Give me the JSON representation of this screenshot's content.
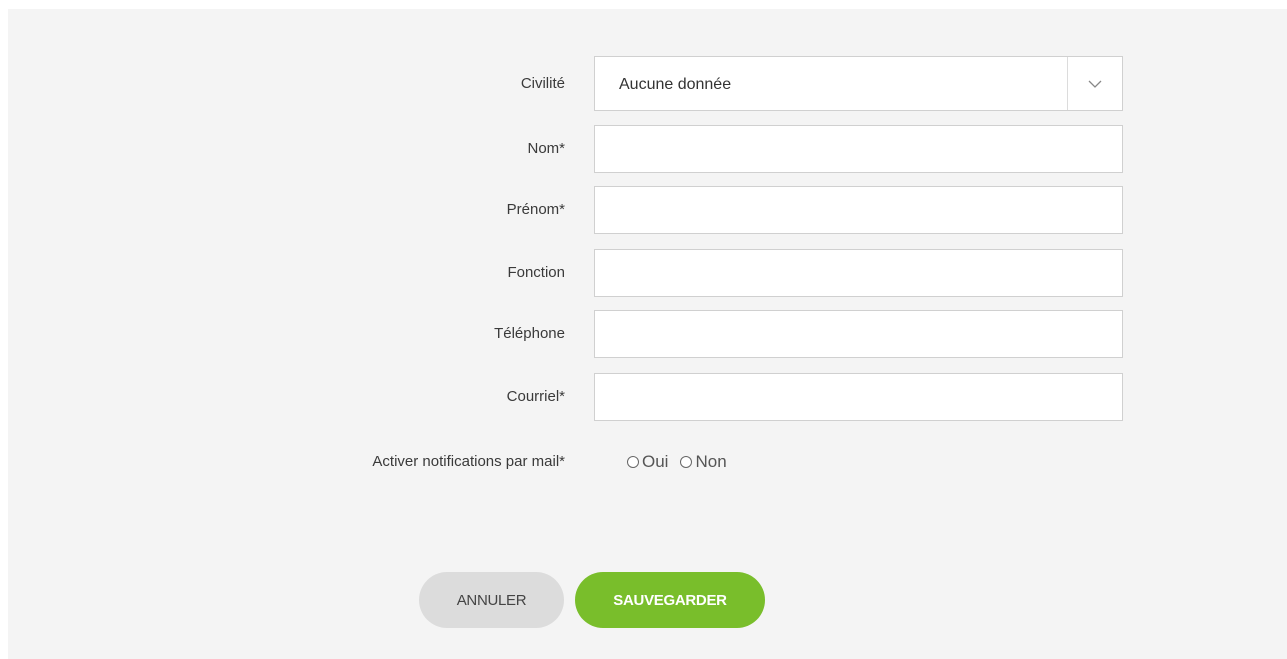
{
  "form": {
    "civilite": {
      "label": "Civilité",
      "selected": "Aucune donnée",
      "chevron_icon": "chevron-down-icon"
    },
    "nom": {
      "label": "Nom*",
      "value": ""
    },
    "prenom": {
      "label": "Prénom*",
      "value": ""
    },
    "fonction": {
      "label": "Fonction",
      "value": ""
    },
    "telephone": {
      "label": "Téléphone",
      "value": ""
    },
    "courriel": {
      "label": "Courriel*",
      "value": ""
    },
    "notifications": {
      "label": "Activer notifications par mail*",
      "options": [
        "Oui",
        "Non"
      ]
    }
  },
  "actions": {
    "cancel_label": "ANNULER",
    "save_label": "SAUVEGARDER"
  },
  "colors": {
    "panel_bg": "#f4f4f4",
    "save_button": "#79be2b",
    "cancel_button": "#dcdcdc"
  }
}
